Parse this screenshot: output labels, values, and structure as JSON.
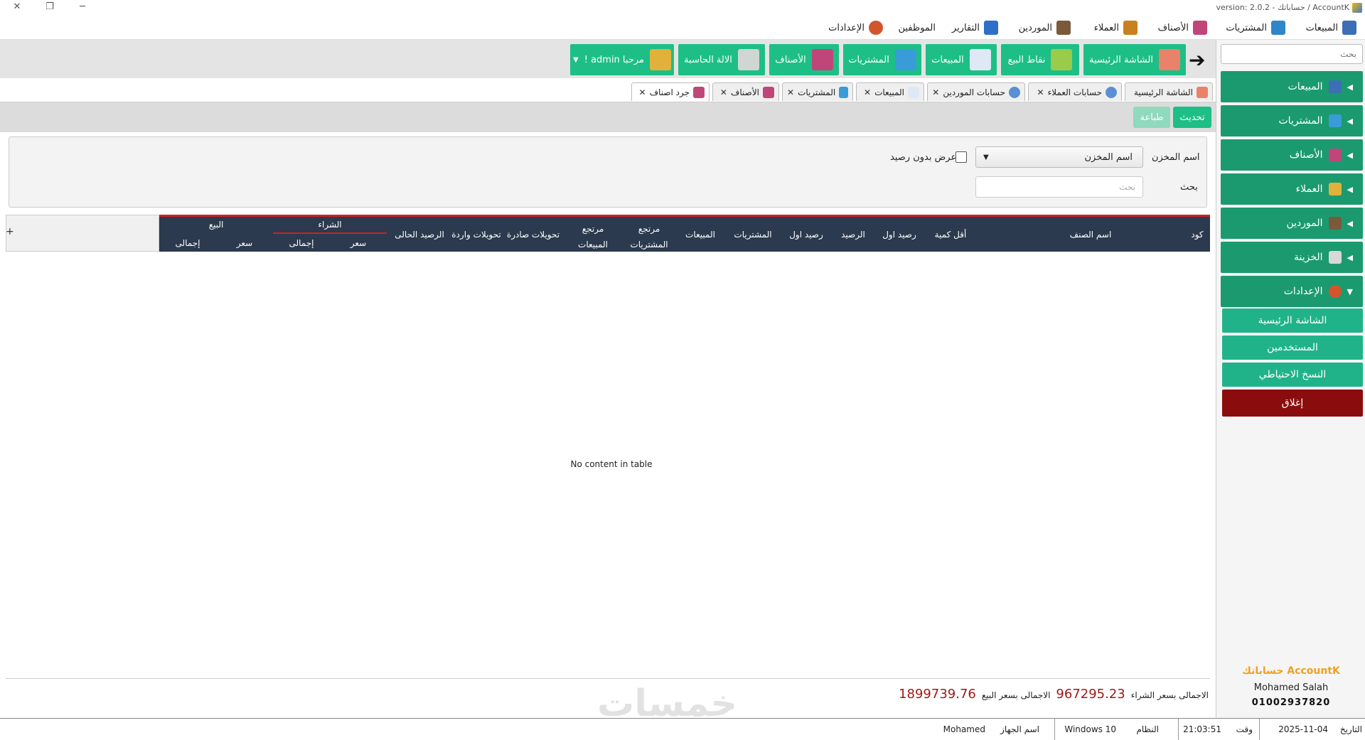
{
  "window": {
    "title": "version: 2.0.2 - حساباتك / AccountK",
    "controls": {
      "close": "✕",
      "maximize": "❐",
      "minimize": "─"
    }
  },
  "menu": {
    "items": [
      {
        "label": "المبيعات",
        "icon": "sales-percent-icon",
        "color": "#3b6fb6"
      },
      {
        "label": "المشتريات",
        "icon": "cart-icon",
        "color": "#2f86c9"
      },
      {
        "label": "الأصناف",
        "icon": "items-box-icon",
        "color": "#c0467a"
      },
      {
        "label": "العملاء",
        "icon": "customers-icon",
        "color": "#c9801f"
      },
      {
        "label": "الموردين",
        "icon": "suppliers-icon",
        "color": "#7a5a3a"
      },
      {
        "label": "التقارير",
        "icon": "reports-icon",
        "color": "#2f6fc9"
      },
      {
        "label": "الموظفين",
        "icon": "",
        "color": ""
      },
      {
        "label": "الإعدادات",
        "icon": "settings-gear-icon",
        "color": "#d2552b"
      }
    ]
  },
  "sidebar": {
    "search_placeholder": "بحث",
    "sections": [
      {
        "label": "المبيعات",
        "arrow": "◀"
      },
      {
        "label": "المشتريات",
        "arrow": "◀"
      },
      {
        "label": "الأصناف",
        "arrow": "◀"
      },
      {
        "label": "العملاء",
        "arrow": "◀"
      },
      {
        "label": "الموردين",
        "arrow": "◀"
      },
      {
        "label": "الخزينة",
        "arrow": "◀"
      },
      {
        "label": "الإعدادات",
        "arrow": "▼"
      }
    ],
    "subitems": [
      "الشاشة الرئيسية",
      "المستخدمين",
      "النسخ الاحتياطي"
    ],
    "close_label": "إغلاق",
    "brand": {
      "logo": "حساباتك AccountK",
      "name": "Mohamed Salah",
      "phone": "01002937820"
    }
  },
  "toolbar": {
    "arrow": "➔",
    "buttons": [
      {
        "label": "الشاشة الرئيسية",
        "icon": "home-icon"
      },
      {
        "label": "نقاط البيع",
        "icon": "pos-bag-icon"
      },
      {
        "label": "المبيعات",
        "icon": "sales-bag-icon"
      },
      {
        "label": "المشتريات",
        "icon": "cart-icon"
      },
      {
        "label": "الأصناف",
        "icon": "items-box-icon"
      },
      {
        "label": "الالة الحاسبة",
        "icon": "calculator-icon"
      },
      {
        "label": "مرحبا admin !",
        "icon": "users-group-icon",
        "caret": "▼"
      }
    ]
  },
  "tabs": [
    {
      "label": "الشاشة الرئيسية",
      "closable": false
    },
    {
      "label": "حسابات العملاء",
      "closable": true
    },
    {
      "label": "حسابات الموردين",
      "closable": true
    },
    {
      "label": "المبيعات",
      "closable": true
    },
    {
      "label": "المشتريات",
      "closable": true
    },
    {
      "label": "الأصناف",
      "closable": true
    },
    {
      "label": "جرد اصناف",
      "closable": true,
      "active": true
    }
  ],
  "actions": {
    "refresh": "تحديث",
    "print": "طباعة"
  },
  "filter": {
    "store_label": "اسم المخزن",
    "store_value": "اسم المخزن",
    "no_balance_label": "عرض بدون رصيد",
    "search_label": "بحث",
    "search_placeholder": "بحث"
  },
  "table": {
    "plus": "+",
    "columns": {
      "code": "كود",
      "item_name": "اسم الصنف",
      "min_qty": "أقل كمية",
      "opening_balance_1": "رصيد اول",
      "balance": "الرصيد",
      "opening_balance_2": "رصيد اول",
      "purchases": "المشتريات",
      "sales": "المبيعات",
      "purchase_returns": "مرتجع المشتريات",
      "sales_returns": "مرتجع المبيعات",
      "transfers_out": "تحويلات صادرة",
      "transfers_in": "تحويلات واردة",
      "current_balance": "الرصيد الحالى",
      "purchase_group": "الشراء",
      "sale_group": "البيع",
      "price": "سعر",
      "total": "إجمالى"
    },
    "empty_text": "No content in table"
  },
  "totals": {
    "purchase_label": "الاجمالى بسعر الشراء",
    "purchase_value": "967295.23",
    "sale_label": "الاجمالى بسعر البيع",
    "sale_value": "1899739.76"
  },
  "watermark": "خمسات",
  "status": {
    "date_label": "التاريخ",
    "date_value": "2025-11-04",
    "time_label": "وقت",
    "time_value": "21:03:51",
    "os_label": "النظام",
    "os_value": "Windows 10",
    "device_label": "اسم الجهاز",
    "device_value": "Mohamed"
  },
  "colors": {
    "accent": "#1dbf86",
    "sidebar_green": "#1b9a6f",
    "close_red": "#8b0c0c",
    "table_header": "#2b3a4e",
    "table_header_border": "#cc2222",
    "total_value": "#a01818"
  }
}
